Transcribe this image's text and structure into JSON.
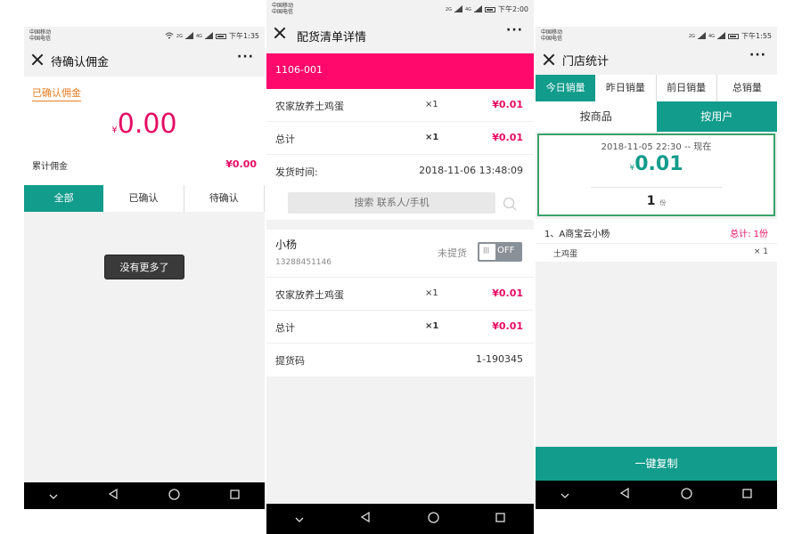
{
  "colors": {
    "accent": "#129c8b",
    "pink": "#ff0a6c",
    "price": "#e60c64",
    "link": "#e87c20",
    "card_border": "#3aa168"
  },
  "phone1": {
    "status": {
      "carrier1": "中国移动",
      "carrier2": "中国电信",
      "time": "下午1:35",
      "sig1": "2G",
      "sig2": "4G"
    },
    "title": "待确认佣金",
    "confirmed_link": "已确认佣金",
    "amount_currency": "¥",
    "amount": "0.00",
    "total_label": "累计佣金",
    "total_value": "¥0.00",
    "tabs": [
      "全部",
      "已确认",
      "待确认"
    ],
    "toast": "没有更多了"
  },
  "phone2": {
    "status": {
      "carrier1": "中国移动",
      "carrier2": "中国电信",
      "time": "下午2:00",
      "sig1": "2G",
      "sig2": "4G"
    },
    "title": "配货清单详情",
    "order_id": "1106-001",
    "item1": {
      "name": "农家放养土鸡蛋",
      "qty": "×1",
      "price": "¥0.01"
    },
    "total1": {
      "label": "总计",
      "qty": "×1",
      "price": "¥0.01"
    },
    "ship_time": {
      "label": "发货时间:",
      "value": "2018-11-06 13:48:09"
    },
    "search_placeholder": "搜索 联系人/手机",
    "user": {
      "name": "小杨",
      "phone": "13288451146",
      "status": "未提货",
      "toggle": "OFF"
    },
    "item2": {
      "name": "农家放养土鸡蛋",
      "qty": "×1",
      "price": "¥0.01"
    },
    "total2": {
      "label": "总计",
      "qty": "×1",
      "price": "¥0.01"
    },
    "pickup": {
      "label": "提货码",
      "value": "1-190345"
    }
  },
  "phone3": {
    "status": {
      "carrier1": "中国移动",
      "carrier2": "中国电信",
      "time": "下午1:55",
      "sig1": "2G",
      "sig2": "4G"
    },
    "title": "门店统计",
    "tabs": [
      "今日销量",
      "昨日销量",
      "前日销量",
      "总销量"
    ],
    "subtabs": [
      "按商品",
      "按用户"
    ],
    "date_range": "2018-11-05 22:30 -- 现在",
    "amount_currency": "¥",
    "amount": "0.01",
    "qty": "1",
    "qty_unit": "份",
    "store_line": "1、A商宝云小杨",
    "store_total": "总计: 1份",
    "item_name": "土鸡蛋",
    "item_qty": "× 1",
    "copy_button": "一键复制"
  }
}
